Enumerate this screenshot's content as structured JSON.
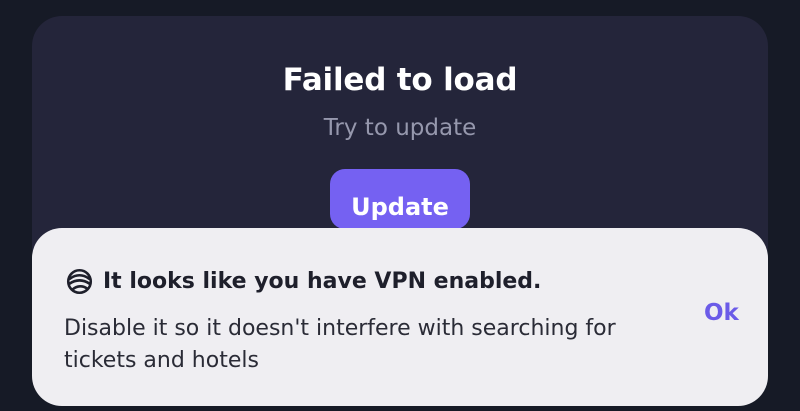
{
  "error_card": {
    "title": "Failed to load",
    "subtitle": "Try to update",
    "update_label": "Update"
  },
  "vpn_notice": {
    "icon": "globe-icon",
    "title": "It looks like you have VPN enabled.",
    "message": "Disable it so it doesn't interfere with searching for tickets and hotels",
    "ok_label": "Ok"
  },
  "colors": {
    "background": "#161a26",
    "card": "#24253a",
    "accent": "#7561f2",
    "toast": "#efeef2",
    "ok_text": "#6b5be8"
  }
}
